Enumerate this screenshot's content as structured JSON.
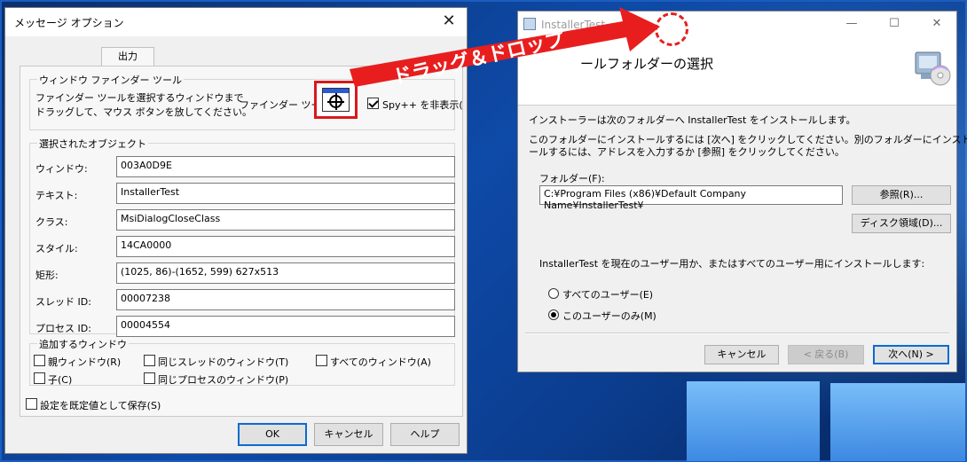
{
  "left_dialog": {
    "title": "メッセージ オプション",
    "close_glyph": "✕",
    "tab_label": "出力",
    "finder_group": {
      "title": "ウィンドウ ファインダー ツール",
      "desc_line1": "ファインダー ツールを選択するウィンドウまで",
      "desc_line2": "ドラッグして、マウス ボタンを放してください。",
      "tool_label": "ファインダー ツール:",
      "hide_spy_label": "Spy++ を非表示(",
      "hide_spy_checked": true
    },
    "selected_group": {
      "title": "選択されたオブジェクト",
      "rows": [
        {
          "label": "ウィンドウ:",
          "value": "003A0D9E"
        },
        {
          "label": "テキスト:",
          "value": "InstallerTest"
        },
        {
          "label": "クラス:",
          "value": "MsiDialogCloseClass"
        },
        {
          "label": "スタイル:",
          "value": "14CA0000"
        },
        {
          "label": "矩形:",
          "value": "(1025, 86)-(1652, 599) 627x513"
        },
        {
          "label": "スレッド ID:",
          "value": "00007238"
        },
        {
          "label": "プロセス ID:",
          "value": "00004554"
        }
      ]
    },
    "add_group": {
      "title": "追加するウィンドウ",
      "parent": "親ウィンドウ(R)",
      "child": "子(C)",
      "same_thread": "同じスレッドのウィンドウ(T)",
      "same_process": "同じプロセスのウィンドウ(P)",
      "all_windows": "すべてのウィンドウ(A)"
    },
    "save_default": "設定を既定値として保存(S)",
    "buttons": {
      "ok": "OK",
      "cancel": "キャンセル",
      "help": "ヘルプ"
    }
  },
  "right_dialog": {
    "title": "InstallerTest",
    "ctrl_minimize": "—",
    "ctrl_maximize": "☐",
    "ctrl_close": "✕",
    "banner_title": "ールフォルダーの選択",
    "intro": "インストーラーは次のフォルダーへ InstallerTest をインストールします。",
    "hint_line1": "このフォルダーにインストールするには [次へ] をクリックしてください。別のフォルダーにインスト",
    "hint_line2": "ールするには、アドレスを入力するか [参照] をクリックしてください。",
    "folder_label": "フォルダー(F):",
    "folder_value": "C:¥Program Files (x86)¥Default Company Name¥InstallerTest¥",
    "browse_button": "参照(R)...",
    "disk_button": "ディスク領域(D)...",
    "scope_question": "InstallerTest を現在のユーザー用か、またはすべてのユーザー用にインストールします:",
    "radio_all": "すべてのユーザー(E)",
    "radio_me": "このユーザーのみ(M)",
    "selected_radio": "radio_me",
    "buttons": {
      "cancel": "キャンセル",
      "back": "< 戻る(B)",
      "next": "次へ(N) >"
    }
  },
  "annotation": {
    "label": "ドラッグ＆ドロップ",
    "arrow_color": "#e81e1e",
    "drop_marker_color": "#e81e1e"
  }
}
